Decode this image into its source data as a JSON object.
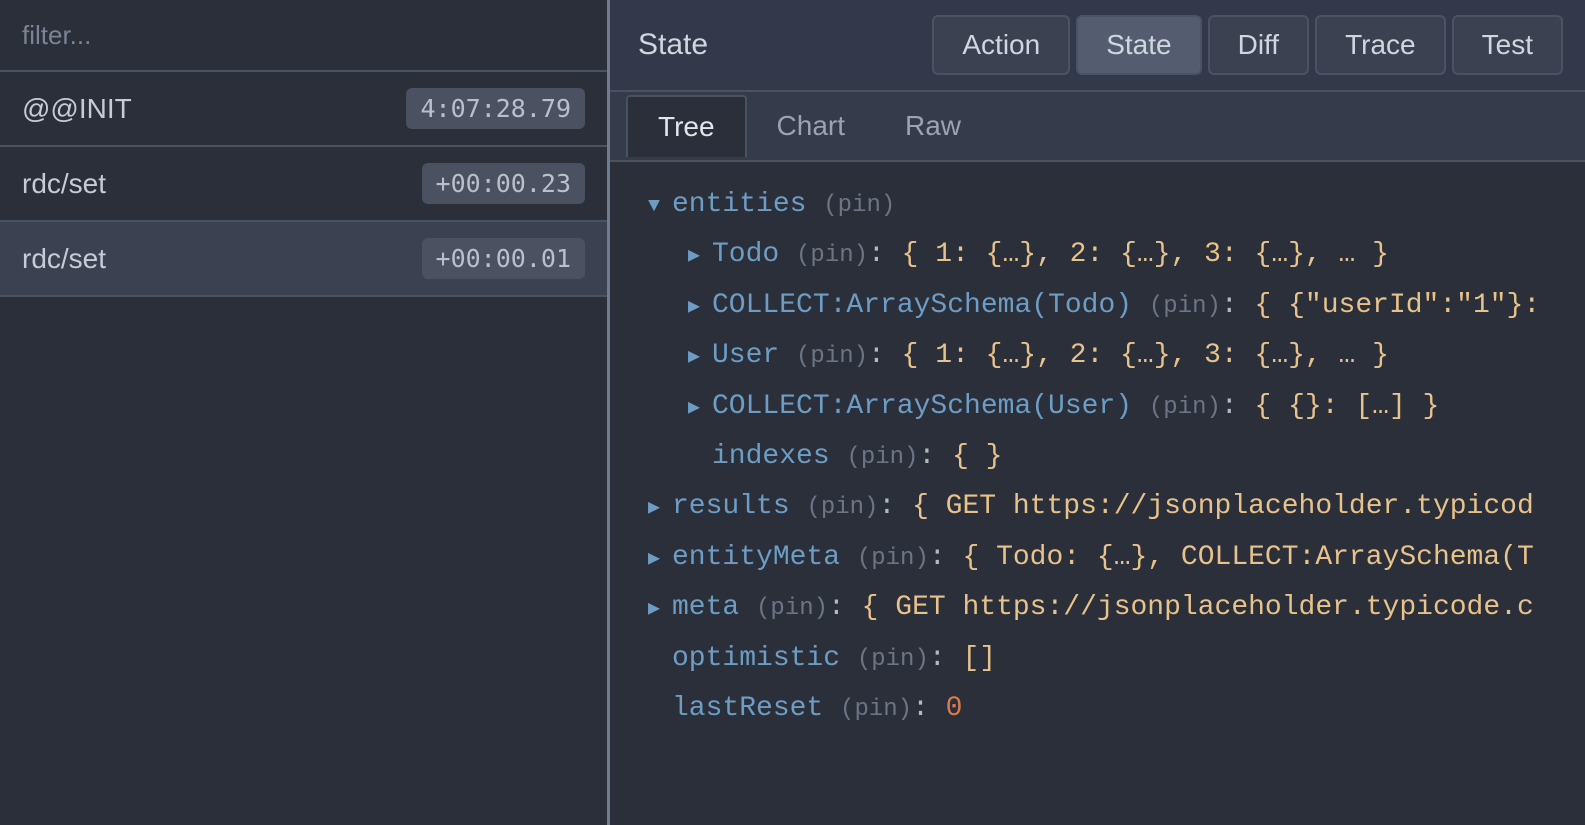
{
  "filter": {
    "placeholder": "filter..."
  },
  "actions": [
    {
      "name": "@@INIT",
      "time": "4:07:28.79",
      "selected": false
    },
    {
      "name": "rdc/set",
      "time": "+00:00.23",
      "selected": false
    },
    {
      "name": "rdc/set",
      "time": "+00:00.01",
      "selected": true
    }
  ],
  "panel": {
    "label": "State",
    "tabs": [
      "Action",
      "State",
      "Diff",
      "Trace",
      "Test"
    ],
    "activeTab": "State",
    "subTabs": [
      "Tree",
      "Chart",
      "Raw"
    ],
    "activeSubTab": "Tree"
  },
  "pinLabel": "(pin)",
  "tree": {
    "entities": {
      "key": "entities",
      "children": [
        {
          "key": "Todo",
          "value": "{ 1: {…}, 2: {…}, 3: {…}, … }",
          "expandable": true
        },
        {
          "key": "COLLECT:ArraySchema(Todo)",
          "value": "{ {\"userId\":\"1\"}:",
          "expandable": true
        },
        {
          "key": "User",
          "value": "{ 1: {…}, 2: {…}, 3: {…}, … }",
          "expandable": true
        },
        {
          "key": "COLLECT:ArraySchema(User)",
          "value": "{ {}: […] }",
          "expandable": true
        },
        {
          "key": "indexes",
          "value": "{ }",
          "expandable": false
        }
      ]
    },
    "topLevel": [
      {
        "key": "results",
        "value": "{ GET https://jsonplaceholder.typicod",
        "expandable": true
      },
      {
        "key": "entityMeta",
        "value": "{ Todo: {…}, COLLECT:ArraySchema(T",
        "expandable": true
      },
      {
        "key": "meta",
        "value": "{ GET https://jsonplaceholder.typicode.c",
        "expandable": true
      },
      {
        "key": "optimistic",
        "value": "[]",
        "expandable": false
      },
      {
        "key": "lastReset",
        "value": "0",
        "expandable": false,
        "numeric": true
      }
    ]
  }
}
